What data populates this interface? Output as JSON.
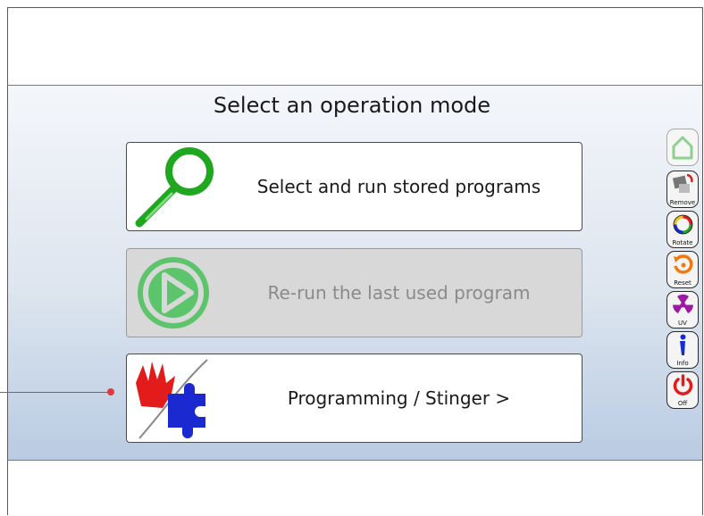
{
  "title": "Select an operation mode",
  "modes": [
    {
      "label": "Select and run stored programs",
      "enabled": true,
      "icon": "magnifier-icon"
    },
    {
      "label": "Re-run the last used program",
      "enabled": false,
      "icon": "play-icon"
    },
    {
      "label": "Programming / Stinger >",
      "enabled": true,
      "icon": "hand-puzzle-icon"
    }
  ],
  "sidebar": {
    "home": {
      "label": "",
      "enabled": false
    },
    "items": [
      {
        "label": "Remove"
      },
      {
        "label": "Rotate"
      },
      {
        "label": "Reset"
      },
      {
        "label": "UV"
      },
      {
        "label": "Info"
      },
      {
        "label": "Off"
      }
    ]
  },
  "colors": {
    "accent_green": "#1fa81f",
    "play_green": "#5cc46a",
    "reset_orange": "#f07a10",
    "uv_purple": "#9a1aa3",
    "info_blue": "#1a2ad0",
    "off_red": "#e31b1b",
    "pointer_red": "#e03a3a"
  }
}
